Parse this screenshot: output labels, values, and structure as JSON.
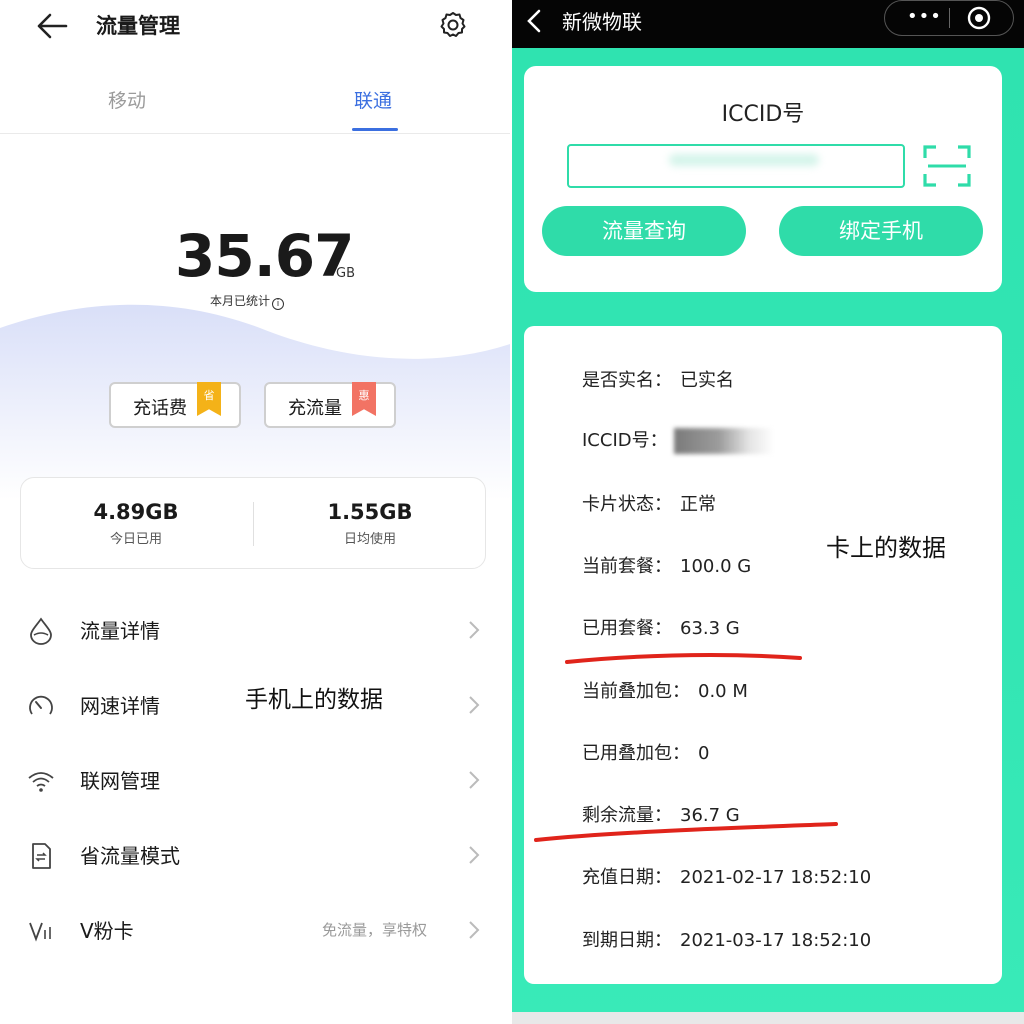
{
  "left": {
    "title": "流量管理",
    "tabs": [
      {
        "label": "移动",
        "active": false
      },
      {
        "label": "联通",
        "active": true
      }
    ],
    "usage": {
      "value": "35.67",
      "unit": "GB",
      "subtitle": "本月已统计"
    },
    "topup": [
      {
        "label": "充话费",
        "badge": "省"
      },
      {
        "label": "充流量",
        "badge": "惠"
      }
    ],
    "stats": [
      {
        "value": "4.89GB",
        "label": "今日已用"
      },
      {
        "value": "1.55GB",
        "label": "日均使用"
      }
    ],
    "menu": [
      {
        "label": "流量详情",
        "icon": "drop-icon"
      },
      {
        "label": "网速详情",
        "icon": "speedometer-icon"
      },
      {
        "label": "联网管理",
        "icon": "wifi-icon"
      },
      {
        "label": "省流量模式",
        "icon": "sim-save-icon"
      },
      {
        "label": "V粉卡",
        "icon": "v-card-icon",
        "sub": "免流量，享特权"
      }
    ],
    "overlay": "手机上的数据",
    "colors": {
      "accent": "#3b6fe0",
      "badge_call": "#f4b218",
      "badge_data": "#f27364"
    }
  },
  "right": {
    "title": "新微物联",
    "capsule": {
      "more": "•••"
    },
    "iccid_title": "ICCID号",
    "buttons": {
      "query": "流量查询",
      "bind": "绑定手机"
    },
    "rows": [
      {
        "key": "是否实名：",
        "value": "已实名"
      },
      {
        "key": "ICCID号：",
        "value": ""
      },
      {
        "key": "卡片状态：",
        "value": "正常"
      },
      {
        "key": "当前套餐：",
        "value": "100.0 G"
      },
      {
        "key": "已用套餐：",
        "value": "63.3 G"
      },
      {
        "key": "当前叠加包：",
        "value": "0.0 M"
      },
      {
        "key": "已用叠加包：",
        "value": "0"
      },
      {
        "key": "剩余流量：",
        "value": "36.7 G"
      },
      {
        "key": "充值日期：",
        "value": "2021-02-17 18:52:10"
      },
      {
        "key": "到期日期：",
        "value": "2021-03-17 18:52:10"
      }
    ],
    "overlay": "卡上的数据",
    "colors": {
      "brand": "#2fdca9",
      "header": "#050505",
      "annotation": "#e0241b"
    }
  }
}
